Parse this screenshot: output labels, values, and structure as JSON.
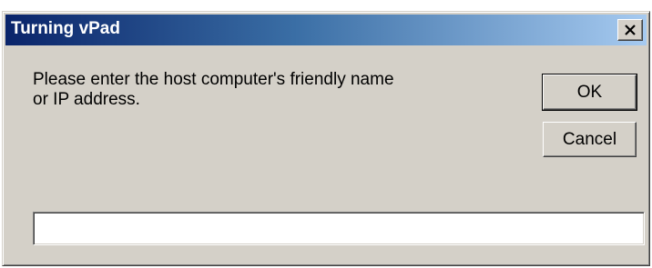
{
  "window": {
    "title": "Turning vPad",
    "close_icon": "close-x-icon"
  },
  "prompt": {
    "line1": "Please enter the host computer's friendly name",
    "line2": "or IP address."
  },
  "buttons": {
    "ok_label": "OK",
    "cancel_label": "Cancel"
  },
  "input": {
    "value": "",
    "placeholder": ""
  },
  "colors": {
    "dialog_face": "#d4d0c8",
    "titlebar_start": "#0a246a",
    "titlebar_end": "#a6caf0",
    "title_text": "#ffffff"
  }
}
